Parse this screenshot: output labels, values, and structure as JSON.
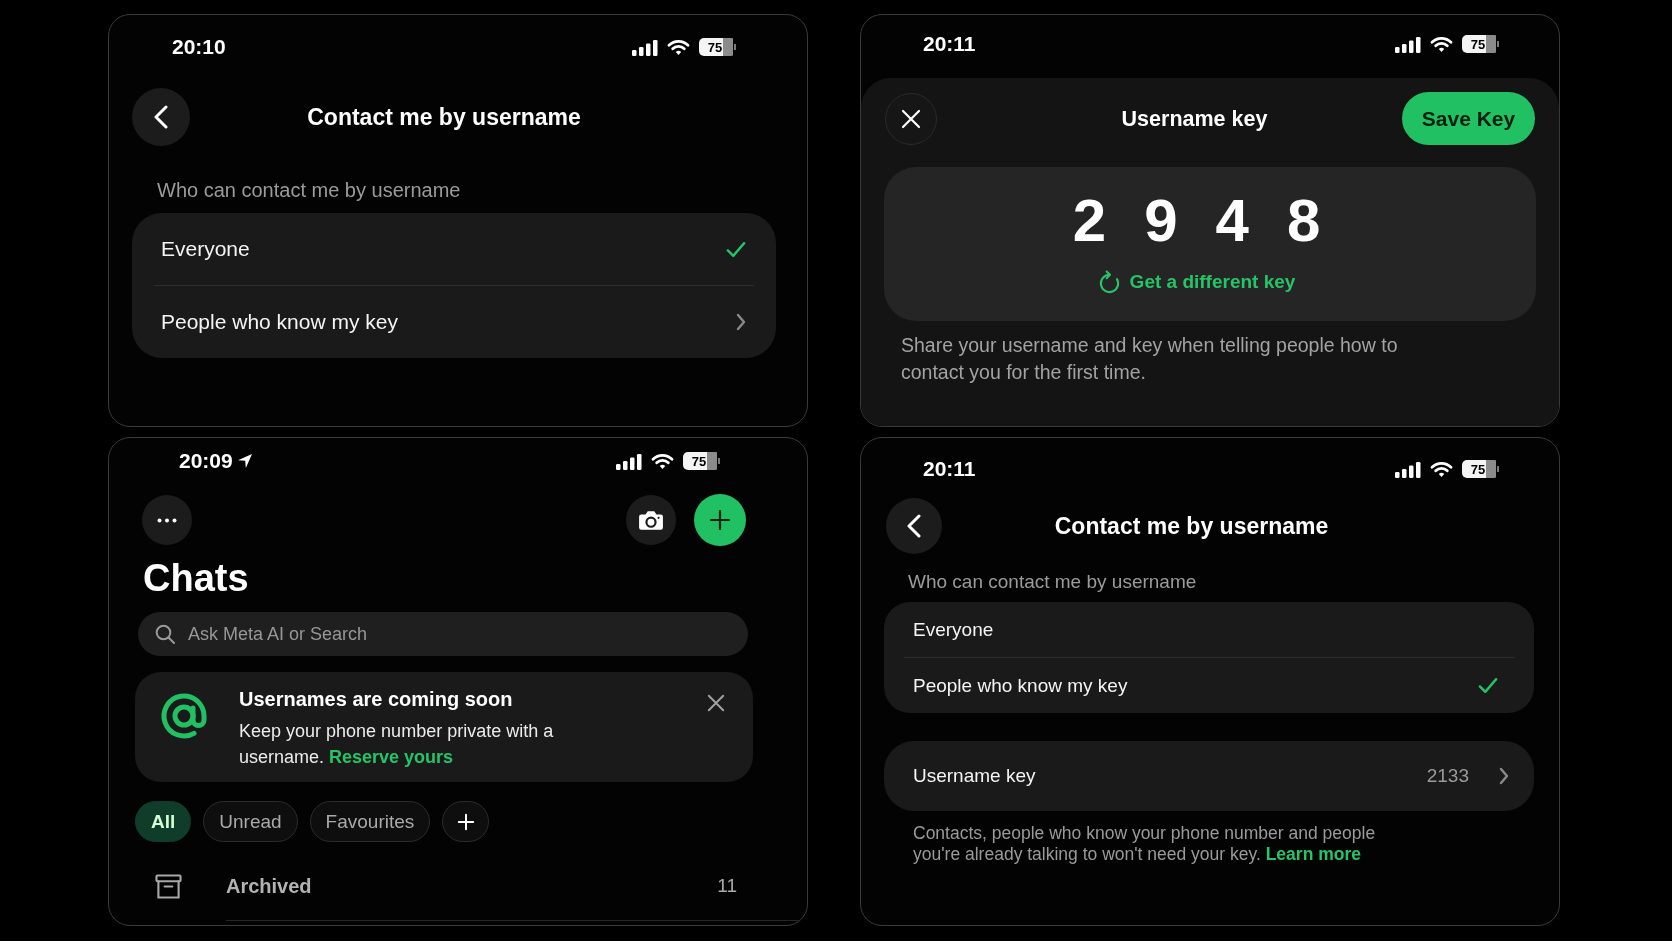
{
  "screens": [
    {
      "kind": "contact_settings",
      "status_bar": {
        "time": "20:10",
        "battery": "75"
      },
      "title": "Contact me by username",
      "section_label": "Who can contact me by username",
      "options": [
        {
          "label": "Everyone",
          "selected": true,
          "chevron": false
        },
        {
          "label": "People who know my key",
          "selected": false,
          "chevron": true
        }
      ]
    },
    {
      "kind": "username_key",
      "status_bar": {
        "time": "20:11",
        "battery": "75"
      },
      "title": "Username key",
      "save_button": "Save Key",
      "key_digits": [
        "2",
        "9",
        "4",
        "8"
      ],
      "refresh_link": "Get a different key",
      "description": "Share your username and key when telling people how to contact you for the first time."
    },
    {
      "kind": "chats",
      "status_bar": {
        "time": "20:09",
        "battery": "75",
        "location": true
      },
      "title": "Chats",
      "search": {
        "placeholder": "Ask Meta AI or Search"
      },
      "banner": {
        "title": "Usernames are coming soon",
        "text": "Keep your phone number private with a username.",
        "link": "Reserve yours"
      },
      "filters": [
        {
          "label": "All",
          "selected": true
        },
        {
          "label": "Unread",
          "selected": false
        },
        {
          "label": "Favourites",
          "selected": false
        }
      ],
      "archived": {
        "label": "Archived",
        "count": "11"
      }
    },
    {
      "kind": "contact_settings",
      "status_bar": {
        "time": "20:11",
        "battery": "75"
      },
      "title": "Contact me by username",
      "section_label": "Who can contact me by username",
      "options": [
        {
          "label": "Everyone",
          "selected": false,
          "chevron": false
        },
        {
          "label": "People who know my key",
          "selected": true,
          "chevron": false
        }
      ],
      "key_row": {
        "label": "Username key",
        "value": "2133"
      },
      "footnote": {
        "text": "Contacts, people who know your phone number and people you're already talking to won't need your key.",
        "link": "Learn more"
      }
    }
  ]
}
